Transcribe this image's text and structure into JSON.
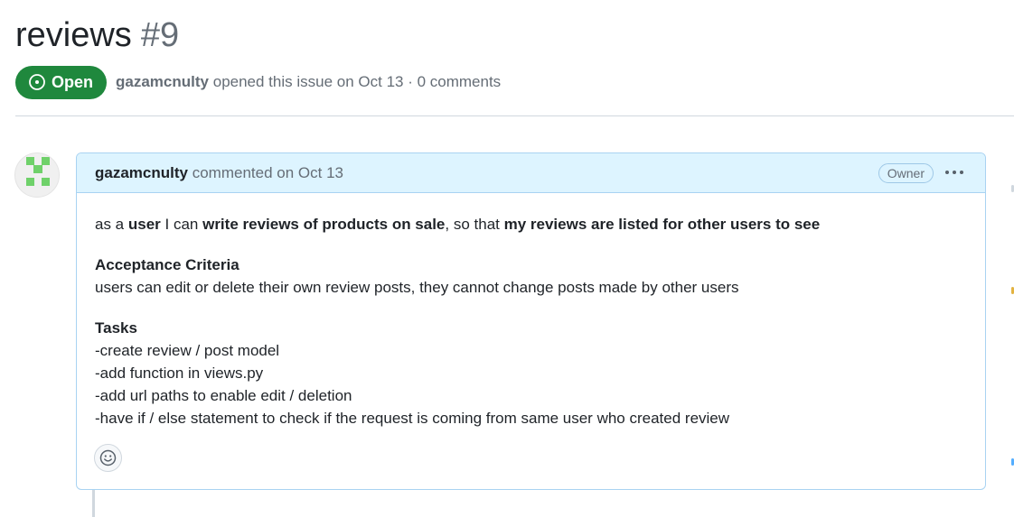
{
  "issue": {
    "title": "reviews",
    "number": "#9",
    "state": "Open",
    "author": "gazamcnulty",
    "opened_text": "opened this issue on Oct 13 · 0 comments"
  },
  "comment": {
    "author": "gazamcnulty",
    "action": "commented",
    "date": "on Oct 13",
    "role_badge": "Owner",
    "body": {
      "story": {
        "p1": "as a ",
        "b1": "user",
        "p2": " I can ",
        "b2": "write reviews of products on sale",
        "p3": ", so that ",
        "b3": "my reviews are listed for other users to see"
      },
      "acceptance_heading": "Acceptance Criteria",
      "acceptance_text": "users can edit or delete their own review posts, they cannot change posts made by other users",
      "tasks_heading": "Tasks",
      "tasks": [
        "-create review / post model",
        "-add function in views.py",
        "-add url paths to enable edit / deletion",
        "-have if / else statement to check if the request is coming from same user who created review"
      ]
    }
  },
  "icons": {
    "state": "issue-opened-icon",
    "more": "kebab-horizontal-icon",
    "reaction": "smiley-icon"
  },
  "colors": {
    "open_green": "#1f883d",
    "header_blue": "#ddf4ff",
    "border_blue": "#a9d3f2",
    "avatar_green": "#6fd16a"
  }
}
